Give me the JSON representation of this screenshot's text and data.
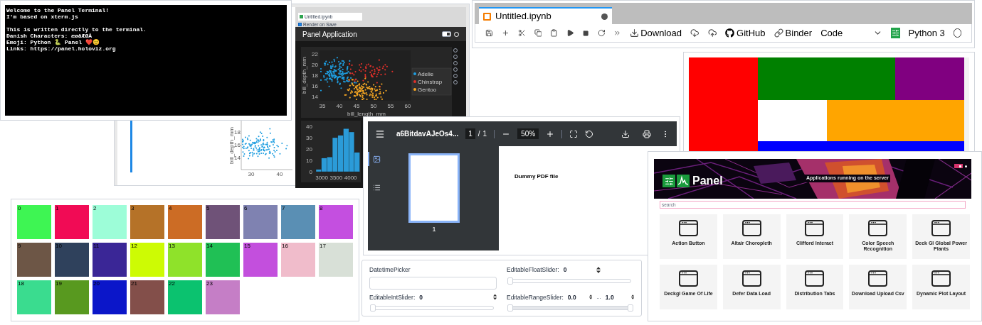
{
  "terminal": {
    "paragraphs": [
      [
        "Welcome to the Panel Terminal!",
        "I'm based on xterm.js"
      ],
      [
        "This is written directly to the terminal.",
        "Danish Characters: æøåÆØÅ",
        "Emoji: Python 🐍 Panel ❤️😊",
        "Links: https://panel.holoviz.org"
      ]
    ]
  },
  "panel_app": {
    "tab": "Untitled.ipynb",
    "render_on_save": {
      "label": "Render on Save",
      "checked": true
    },
    "title": "Panel Application",
    "side_scatter": {
      "ylabel": "bill_depth_mm",
      "yticks": [
        "18",
        "16",
        "14"
      ],
      "xticks": [
        "30",
        "40"
      ]
    },
    "scatter": {
      "xlabel": "bill_length_mm",
      "ylabel": "bill_depth_mm",
      "xticks": [
        "35",
        "40",
        "45",
        "50",
        "55",
        "60"
      ],
      "yticks": [
        "22",
        "20",
        "18",
        "16",
        "14"
      ],
      "legend": [
        {
          "name": "Adelie",
          "color": "#1f9ee0"
        },
        {
          "name": "Chinstrap",
          "color": "#e0302a"
        },
        {
          "name": "Gentoo",
          "color": "#f5a623"
        }
      ]
    },
    "theme_toggle": {
      "on": true
    },
    "histogram": {
      "chart_data": {
        "type": "bar",
        "x": [
          2800,
          2990,
          3180,
          3370,
          3560,
          3750,
          3940,
          4130
        ],
        "values": [
          2,
          12,
          13,
          30,
          32,
          38,
          35,
          17
        ],
        "xlim": [
          2750,
          4330
        ],
        "ylim": [
          0,
          40
        ],
        "yticks": [
          0,
          10,
          20,
          30,
          40
        ],
        "xticks": [
          3000,
          3500,
          4000
        ]
      }
    }
  },
  "jupyter": {
    "tab": {
      "title": "Untitled.ipynb",
      "unsaved": true
    },
    "toolbar": {
      "download": "Download",
      "github": "GitHub",
      "binder": "Binder",
      "cell_type": "Code",
      "kernel": "Python 3",
      "kernel_busy": false
    }
  },
  "color_blocks": [
    {
      "color": "#ff0000"
    },
    {
      "color": "#008000"
    },
    {
      "color": "#800080"
    },
    {
      "color": "#ffffff"
    },
    {
      "color": "#ffa500"
    },
    {
      "color": "#0000ff"
    }
  ],
  "swatches": [
    {
      "label": "0",
      "color": "#3ef553"
    },
    {
      "label": "1",
      "color": "#f10b55"
    },
    {
      "label": "2",
      "color": "#9dfdd8"
    },
    {
      "label": "3",
      "color": "#b57228"
    },
    {
      "label": "4",
      "color": "#cc6c25"
    },
    {
      "label": "5",
      "color": "#6f5278"
    },
    {
      "label": "6",
      "color": "#7f82b1"
    },
    {
      "label": "7",
      "color": "#5a8fb4"
    },
    {
      "label": "8",
      "color": "#c44fe0"
    },
    {
      "label": "9",
      "color": "#6d5646"
    },
    {
      "label": "10",
      "color": "#2f415c"
    },
    {
      "label": "11",
      "color": "#3a2696"
    },
    {
      "label": "12",
      "color": "#cdfb04"
    },
    {
      "label": "13",
      "color": "#8fe22a"
    },
    {
      "label": "14",
      "color": "#20c055"
    },
    {
      "label": "15",
      "color": "#c34fdd"
    },
    {
      "label": "16",
      "color": "#f0bccb"
    },
    {
      "label": "17",
      "color": "#d8e0d7"
    },
    {
      "label": "18",
      "color": "#3adc8f"
    },
    {
      "label": "19",
      "color": "#58991f"
    },
    {
      "label": "20",
      "color": "#0b16c9"
    },
    {
      "label": "21",
      "color": "#834f4a"
    },
    {
      "label": "22",
      "color": "#0bc26f"
    },
    {
      "label": "23",
      "color": "#c57ec6"
    }
  ],
  "pdf": {
    "title": "a6BitdavAJeOs4...",
    "page": "1",
    "page_sep": "/",
    "page_count": "1",
    "zoom": "50%",
    "thumbnail_label": "1",
    "content": "Dummy PDF file",
    "sidebar": [
      {
        "kind": "thumbnails",
        "selected": true
      },
      {
        "kind": "outline",
        "selected": false
      }
    ]
  },
  "widgets": {
    "datetime": {
      "label": "DatetimePicker"
    },
    "float_slider": {
      "label": "EditableFloatSlider:",
      "value": "0",
      "level": 0
    },
    "int_slider": {
      "label": "EditableIntSlider:",
      "value": "0",
      "level": 0
    },
    "range_slider": {
      "label": "EditableRangeSlider:",
      "start": "0.0",
      "sep": "...",
      "end": "1.0",
      "handles": [
        {
          "level": 0
        },
        {
          "level": 1
        }
      ]
    }
  },
  "gallery": {
    "brand": "Panel",
    "toggle": {
      "on": true
    },
    "subtitle": "Applications running on the server",
    "search": {
      "placeholder": "search"
    },
    "apps": [
      "Action Button",
      "Altair Choropleth",
      "Clifford Interact",
      "Color Speech Recognition",
      "Deck Gl Global Power Plants",
      "Deckgl Game Of Life",
      "Defer Data Load",
      "Distribution Tabs",
      "Download Upload Csv",
      "Dynamic Plot Layout"
    ]
  }
}
